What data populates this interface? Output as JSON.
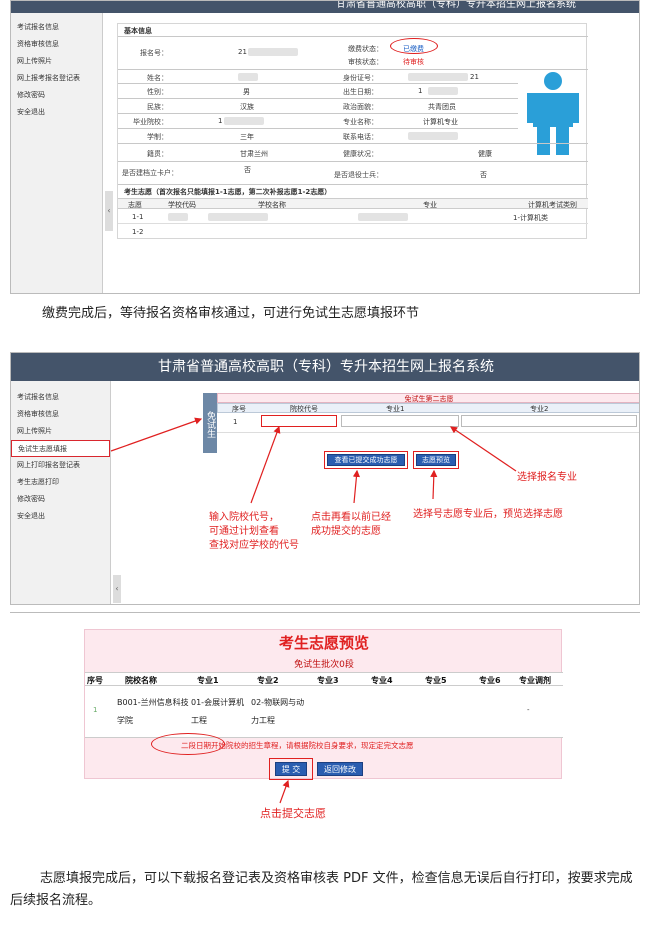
{
  "shot1": {
    "top_title": "甘肃省普通高校高职（专科）专升本招生网上报名系统",
    "sidebar": [
      "考试报名信息",
      "资格审核信息",
      "网上传照片",
      "网上报考报名登记表",
      "修改密码",
      "安全退出"
    ],
    "section_title": "基本信息",
    "fields": {
      "reg_no_label": "报名号：",
      "reg_no_value": "21",
      "pay_label": "缴费状态：",
      "pay_value": "已缴费",
      "audit_label": "审核状态：",
      "audit_value": "待审核",
      "name_label": "姓名：",
      "id_label": "身份证号：",
      "id_value": "21",
      "gender_label": "性别：",
      "gender_value": "男",
      "birth_label": "出生日期：",
      "birth_value": "1",
      "nation_label": "民族：",
      "nation_value": "汉族",
      "politic_label": "政治面貌：",
      "politic_value": "共青团员",
      "school_label": "毕业院校：",
      "school_value": "1",
      "major_label": "专业名称：",
      "major_value": "计算机专业",
      "edu_label": "学制：",
      "edu_value": "三年",
      "phone_label": "联系电话：",
      "origin_label": "籍贯：",
      "origin_value": "甘肃兰州",
      "health_label": "健康状况：",
      "health_value": "健康",
      "card_label": "是否建档立卡户：",
      "card_value": "否",
      "soldier_label": "是否退役士兵：",
      "soldier_value": "否"
    },
    "wish_title": "考生志愿（首次报名只能填报1-1志愿，第二次补报志愿1-2志愿）",
    "wish_headers": [
      "志愿",
      "学校代码",
      "学校名称",
      "专业",
      "计算机考试类别"
    ],
    "wish_rows": [
      [
        "1-1",
        "",
        "",
        "",
        "1-计算机类"
      ],
      [
        "1-2",
        "",
        "",
        "",
        ""
      ]
    ]
  },
  "para1": "缴费完成后，等待报名资格审核通过，可进行免试生志愿填报环节",
  "shot2": {
    "header": "甘肃省普通高校高职（专科）专升本招生网上报名系统",
    "sidebar": [
      "考试报名信息",
      "资格审核信息",
      "网上传照片",
      "免试生志愿填报",
      "网上打印报名登记表",
      "考生志愿打印",
      "修改密码",
      "安全退出"
    ],
    "side_label": "免试生",
    "table_title": "免试生第二志愿",
    "headers": [
      "序号",
      "院校代号",
      "专业1",
      "专业2"
    ],
    "row_no": "1",
    "btn_query": "查看已提交成功志愿",
    "btn_submit": "志愿预览",
    "ann1": "输入院校代号，\n可通过计划查看\n查找对应学校的代号",
    "ann2": "点击再看以前已经\n成功提交的志愿",
    "ann3": "选择号志愿专业后，预览选择志愿",
    "ann4": "选择报名专业"
  },
  "shot3": {
    "title": "考生志愿预览",
    "subtitle": "免试生批次0段",
    "headers": [
      "序号",
      "院校名称",
      "专业1",
      "专业2",
      "专业3",
      "专业4",
      "专业5",
      "专业6",
      "专业调剂"
    ],
    "row": [
      "1",
      "B001-兰州信息科技学院",
      "01-会展计算机工程",
      "02-物联网与动力工程",
      "",
      "",
      "",
      "",
      "-"
    ],
    "notice": "二段日期开始院校的招生章程，请根据院校自身要求，现定定完文志愿",
    "btn_ok": "提 交",
    "btn_back": "返回修改",
    "ann": "点击提交志愿"
  },
  "para2": "志愿填报完成后，可以下载报名登记表及资格审核表 PDF 文件，检查信息无误后自行打印，按要求完成后续报名流程。"
}
